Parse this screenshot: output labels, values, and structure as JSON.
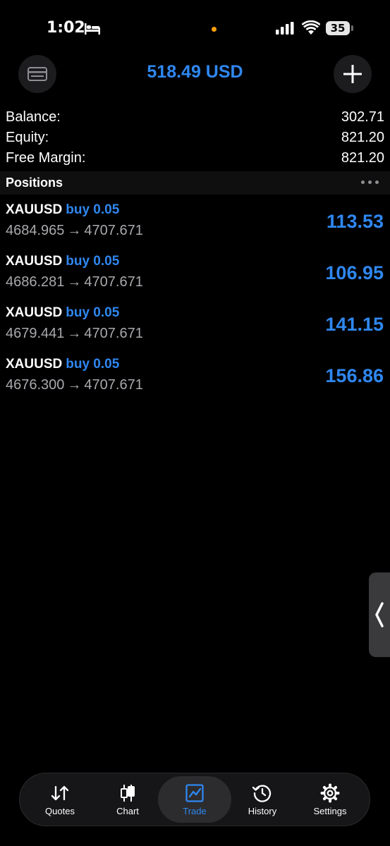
{
  "status_bar": {
    "time": "1:02",
    "battery": "35"
  },
  "header": {
    "title": "518.49 USD"
  },
  "summary": [
    {
      "label": "Balance:",
      "value": "302.71"
    },
    {
      "label": "Equity:",
      "value": "821.20"
    },
    {
      "label": "Free Margin:",
      "value": "821.20"
    }
  ],
  "positions_section": {
    "title": "Positions"
  },
  "positions": [
    {
      "symbol": "XAUUSD",
      "type": "buy 0.05",
      "open_price": "4684.965",
      "arrow": "→",
      "current_price": "4707.671",
      "profit": "113.53"
    },
    {
      "symbol": "XAUUSD",
      "type": "buy 0.05",
      "open_price": "4686.281",
      "arrow": "→",
      "current_price": "4707.671",
      "profit": "106.95"
    },
    {
      "symbol": "XAUUSD",
      "type": "buy 0.05",
      "open_price": "4679.441",
      "arrow": "→",
      "current_price": "4707.671",
      "profit": "141.15"
    },
    {
      "symbol": "XAUUSD",
      "type": "buy 0.05",
      "open_price": "4676.300",
      "arrow": "→",
      "current_price": "4707.671",
      "profit": "156.86"
    }
  ],
  "tabs": [
    {
      "label": "Quotes",
      "icon": "quotes-arrows-icon"
    },
    {
      "label": "Chart",
      "icon": "candlestick-icon"
    },
    {
      "label": "Trade",
      "icon": "trade-chart-icon"
    },
    {
      "label": "History",
      "icon": "history-clock-icon"
    },
    {
      "label": "Settings",
      "icon": "gear-icon"
    }
  ],
  "colors": {
    "accent": "#2f87f0",
    "background": "#000000",
    "secondary_text": "#a9a9ae",
    "status_dot": "#ff9f0a"
  }
}
